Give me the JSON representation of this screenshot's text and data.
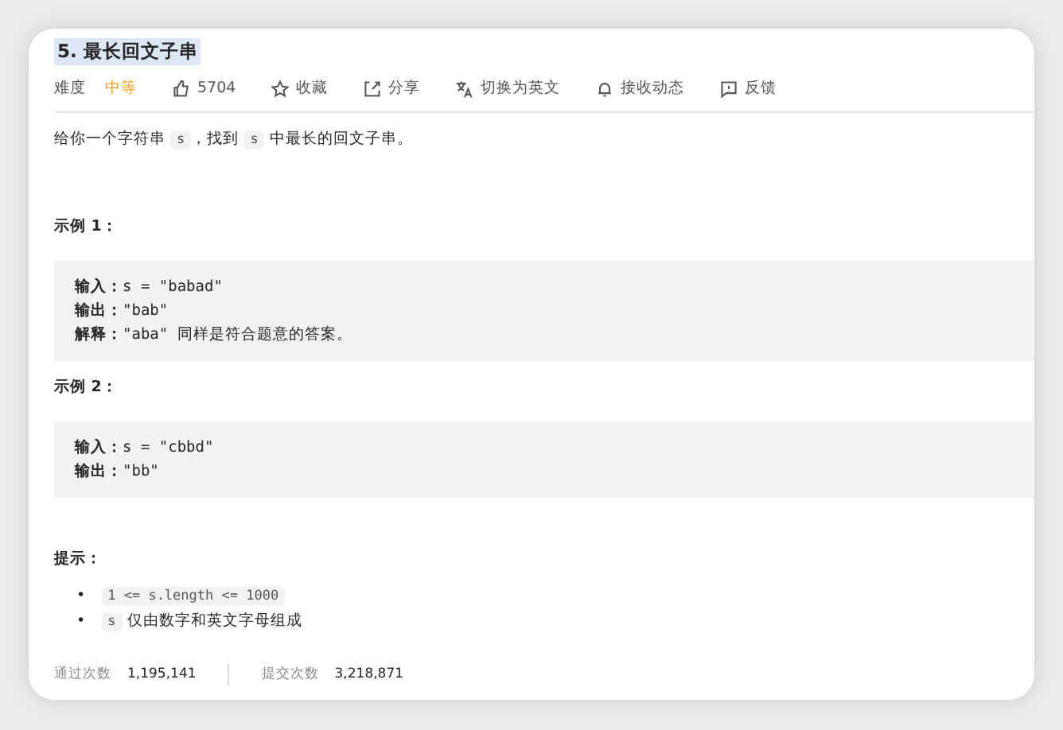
{
  "title": "5. 最长回文子串",
  "toolbar": [
    {
      "kind": "difficulty",
      "label": "难度",
      "value": "中等"
    },
    {
      "kind": "like",
      "label": "5704"
    },
    {
      "kind": "star",
      "label": "收藏"
    },
    {
      "kind": "share",
      "label": "分享"
    },
    {
      "kind": "translate",
      "label": "切换为英文"
    },
    {
      "kind": "bell",
      "label": "接收动态"
    },
    {
      "kind": "feedback",
      "label": "反馈"
    }
  ],
  "description": [
    {
      "kind": "text",
      "text": "给你一个字符串 "
    },
    {
      "kind": "code",
      "text": "s"
    },
    {
      "kind": "text",
      "text": "，找到 "
    },
    {
      "kind": "code",
      "text": "s"
    },
    {
      "kind": "text",
      "text": " 中最长的回文子串。"
    }
  ],
  "examples": [
    {
      "heading": "示例 1：",
      "lines": [
        {
          "label": "输入：",
          "value": "s = \"babad\""
        },
        {
          "label": "输出：",
          "value": "\"bab\""
        },
        {
          "label": "解释：",
          "value": "\"aba\" 同样是符合题意的答案。"
        }
      ]
    },
    {
      "heading": "示例 2：",
      "lines": [
        {
          "label": "输入：",
          "value": "s = \"cbbd\""
        },
        {
          "label": "输出：",
          "value": "\"bb\""
        }
      ]
    }
  ],
  "hints": {
    "heading": "提示：",
    "items": [
      {
        "marker": "•",
        "segments": [
          {
            "kind": "code",
            "text": "1 <= s.length <= 1000"
          }
        ]
      },
      {
        "marker": "•",
        "segments": [
          {
            "kind": "code",
            "text": "s"
          },
          {
            "kind": "text",
            "text": " 仅由数字和英文字母组成"
          }
        ]
      }
    ]
  },
  "stats": [
    {
      "label": "通过次数",
      "value": "1,195,141"
    },
    {
      "label": "提交次数",
      "value": "3,218,871"
    }
  ]
}
